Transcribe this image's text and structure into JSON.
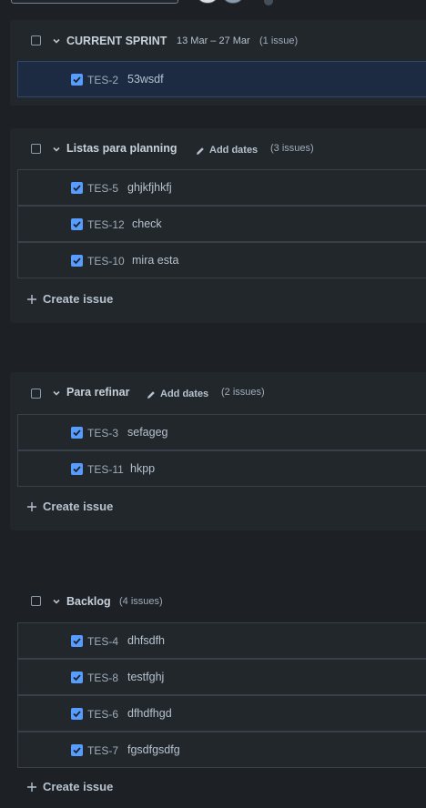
{
  "sprints": [
    {
      "name": "CURRENT SPRINT",
      "dates": "13 Mar – 27 Mar",
      "count": "(1 issue)",
      "issues": [
        {
          "key": "TES-2",
          "summary": "53wsdf"
        }
      ]
    },
    {
      "name": "Listas para planning",
      "add_dates": "Add dates",
      "count": "(3 issues)",
      "issues": [
        {
          "key": "TES-5",
          "summary": "ghjkfjhkfj"
        },
        {
          "key": "TES-12",
          "summary": "check"
        },
        {
          "key": "TES-10",
          "summary": "mira esta"
        }
      ],
      "create": "Create issue"
    },
    {
      "name": "Para refinar",
      "add_dates": "Add dates",
      "count": "(2 issues)",
      "issues": [
        {
          "key": "TES-3",
          "summary": "sefageg"
        },
        {
          "key": "TES-11",
          "summary": "hkpp"
        }
      ],
      "create": "Create issue"
    },
    {
      "name": "Backlog",
      "count": "(4 issues)",
      "issues": [
        {
          "key": "TES-4",
          "summary": "dhfsdfh"
        },
        {
          "key": "TES-8",
          "summary": "testfghj"
        },
        {
          "key": "TES-6",
          "summary": "dfhdfhgd"
        },
        {
          "key": "TES-7",
          "summary": "fgsdfgsdfg"
        }
      ],
      "create": "Create issue"
    }
  ],
  "icons": {
    "checkbox": "checkbox-icon",
    "chevron": "chevron-down-icon",
    "pencil": "pencil-icon",
    "plus": "plus-icon",
    "checked": "checkmark-icon"
  },
  "colors": {
    "background": "#1d2125",
    "panel": "#22272b",
    "selected_row": "#1c2b41",
    "checkbox_checked": "#579dff"
  }
}
